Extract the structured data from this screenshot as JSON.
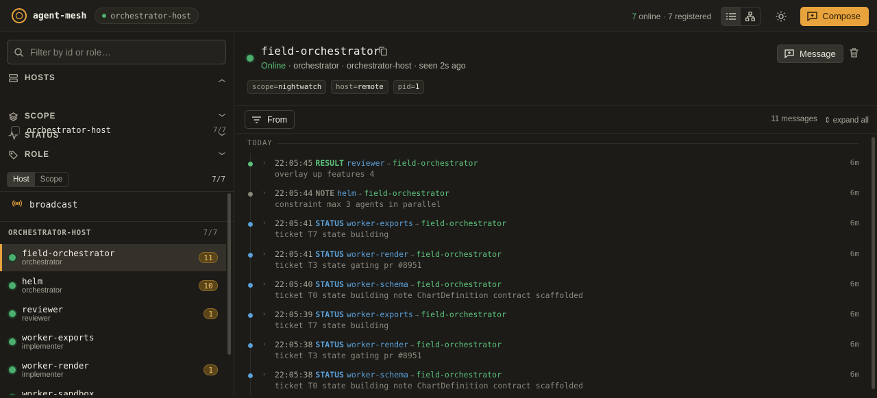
{
  "topbar": {
    "app_title": "agent-mesh",
    "host_pill": "orchestrator-host",
    "online_count": "7",
    "online_label": "online",
    "registered": "7 registered",
    "compose_label": "Compose"
  },
  "sidebar": {
    "filter_placeholder": "Filter by id or role…",
    "facets": {
      "hosts": "HOSTS",
      "scope": "SCOPE",
      "status": "STATUS",
      "role": "ROLE"
    },
    "host_option": {
      "name": "orchestrator-host",
      "count": "7/7"
    },
    "group_by": {
      "host": "Host",
      "scope": "Scope",
      "count": "7/7"
    },
    "broadcast": "broadcast",
    "group": {
      "name": "ORCHESTRATOR-HOST",
      "count": "7/7"
    },
    "agents": [
      {
        "name": "field-orchestrator",
        "role": "orchestrator",
        "badge": "11",
        "selected": true
      },
      {
        "name": "helm",
        "role": "orchestrator",
        "badge": "10"
      },
      {
        "name": "reviewer",
        "role": "reviewer",
        "badge": "1"
      },
      {
        "name": "worker-exports",
        "role": "implementer",
        "badge": ""
      },
      {
        "name": "worker-render",
        "role": "implementer",
        "badge": "1"
      },
      {
        "name": "worker-sandbox",
        "role": "",
        "badge": ""
      }
    ]
  },
  "detail": {
    "name": "field-orchestrator",
    "status": "Online",
    "meta": " · orchestrator · orchestrator-host · seen 2s ago",
    "tags": [
      {
        "key": "scope=",
        "value": "nightwatch"
      },
      {
        "key": "host=",
        "value": "remote"
      },
      {
        "key": "pid=",
        "value": "1"
      }
    ],
    "message_label": "Message"
  },
  "feed": {
    "from_label": "From",
    "count": "11 messages",
    "expand": "expand all",
    "day": "TODAY",
    "colors": {
      "result": "#5cc17a",
      "note": "#8a867a",
      "status": "#5b9fd6"
    },
    "messages": [
      {
        "time": "22:05:45",
        "kind": "RESULT",
        "from": "reviewer",
        "to": "field-orchestrator",
        "body": "overlay up features 4",
        "ago": "6m"
      },
      {
        "time": "22:05:44",
        "kind": "NOTE",
        "from": "helm",
        "to": "field-orchestrator",
        "body": "constraint max 3 agents in parallel",
        "ago": "6m"
      },
      {
        "time": "22:05:41",
        "kind": "STATUS",
        "from": "worker-exports",
        "to": "field-orchestrator",
        "body": "ticket T7 state building",
        "ago": "6m"
      },
      {
        "time": "22:05:41",
        "kind": "STATUS",
        "from": "worker-render",
        "to": "field-orchestrator",
        "body": "ticket T3 state gating pr #8951",
        "ago": "6m"
      },
      {
        "time": "22:05:40",
        "kind": "STATUS",
        "from": "worker-schema",
        "to": "field-orchestrator",
        "body": "ticket T0 state building note ChartDefinition contract scaffolded",
        "ago": "6m"
      },
      {
        "time": "22:05:39",
        "kind": "STATUS",
        "from": "worker-exports",
        "to": "field-orchestrator",
        "body": "ticket T7 state building",
        "ago": "6m"
      },
      {
        "time": "22:05:38",
        "kind": "STATUS",
        "from": "worker-render",
        "to": "field-orchestrator",
        "body": "ticket T3 state gating pr #8951",
        "ago": "6m"
      },
      {
        "time": "22:05:38",
        "kind": "STATUS",
        "from": "worker-schema",
        "to": "field-orchestrator",
        "body": "ticket T0 state building note ChartDefinition contract scaffolded",
        "ago": "6m"
      }
    ]
  }
}
